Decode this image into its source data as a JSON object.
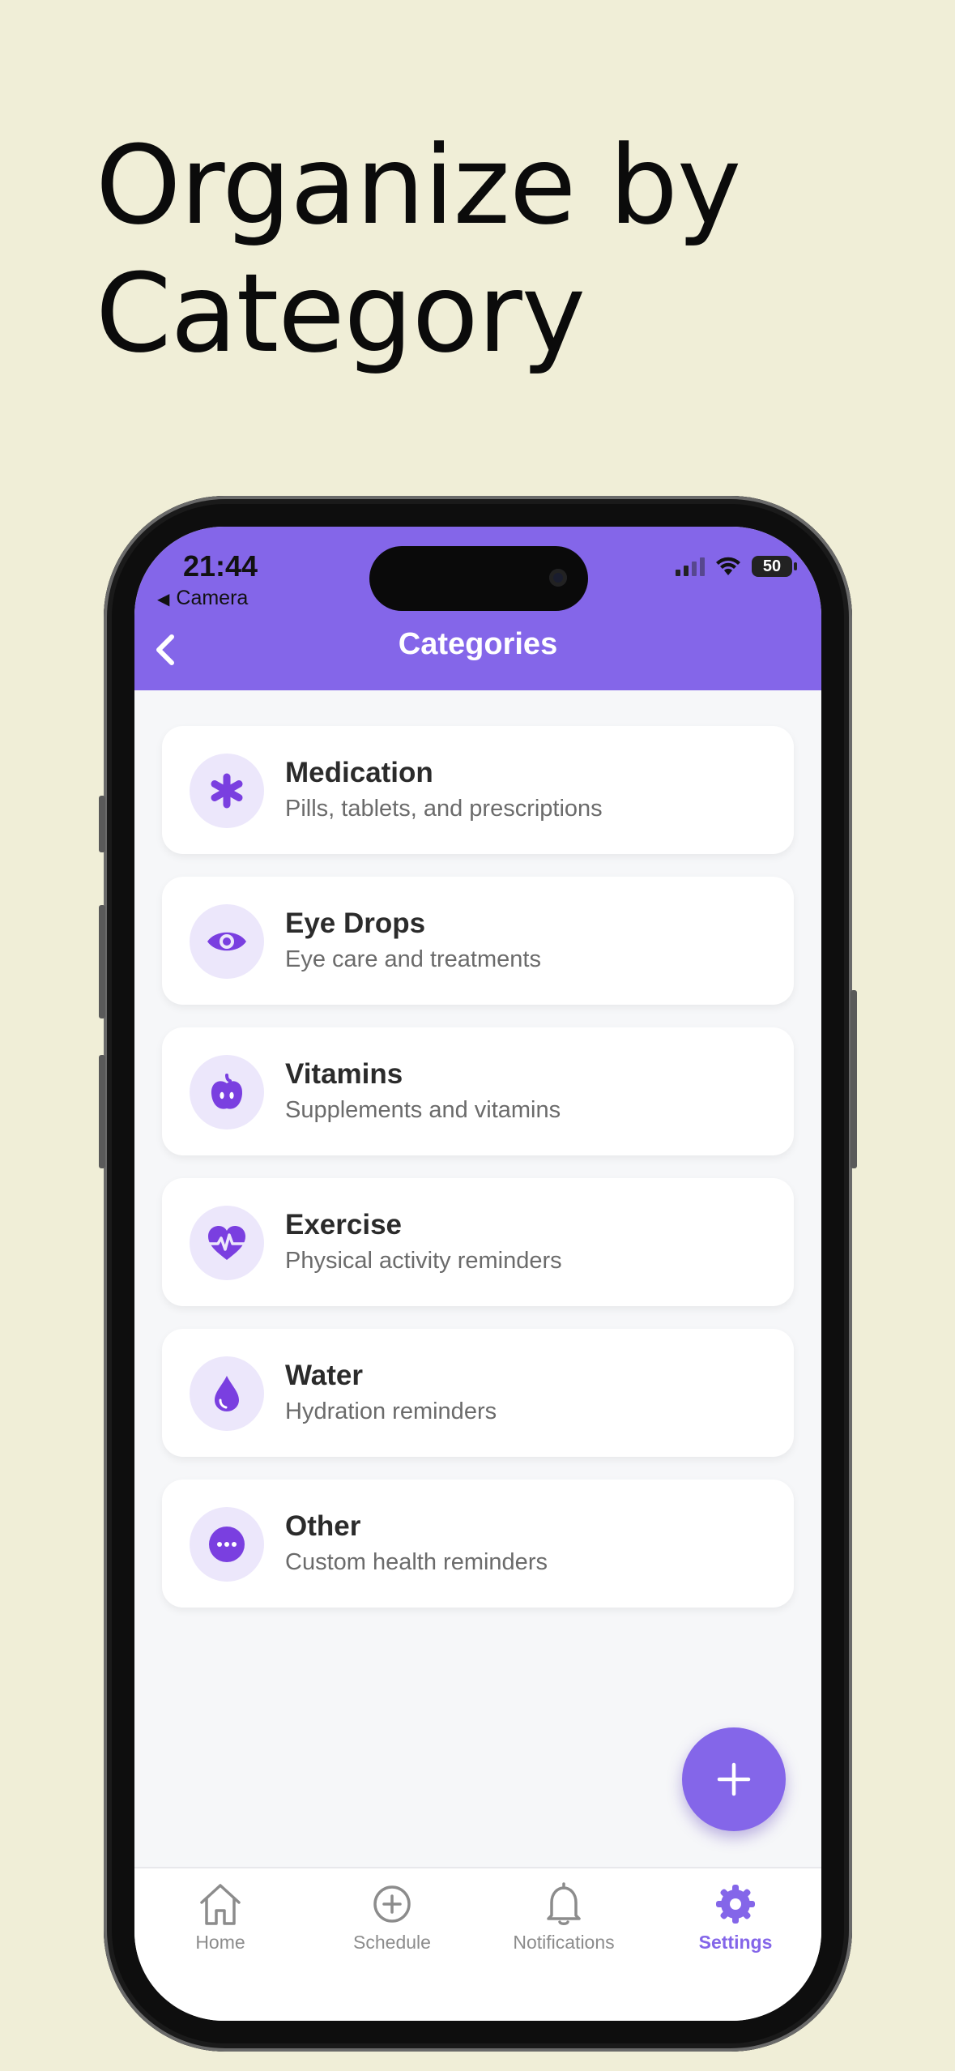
{
  "headline": {
    "line1": "Organize by",
    "line2": "Category"
  },
  "status_bar": {
    "time": "21:44",
    "back_app": "Camera",
    "battery": "50"
  },
  "nav": {
    "title": "Categories"
  },
  "categories": [
    {
      "title": "Medication",
      "subtitle": "Pills, tablets, and prescriptions",
      "icon": "asterisk-icon"
    },
    {
      "title": "Eye Drops",
      "subtitle": "Eye care and treatments",
      "icon": "eye-icon"
    },
    {
      "title": "Vitamins",
      "subtitle": "Supplements and vitamins",
      "icon": "apple-icon"
    },
    {
      "title": "Exercise",
      "subtitle": "Physical activity reminders",
      "icon": "heartbeat-icon"
    },
    {
      "title": "Water",
      "subtitle": "Hydration reminders",
      "icon": "water-drop-icon"
    },
    {
      "title": "Other",
      "subtitle": "Custom health reminders",
      "icon": "ellipsis-circle-icon"
    }
  ],
  "tabs": [
    {
      "label": "Home",
      "icon": "home-icon",
      "active": false
    },
    {
      "label": "Schedule",
      "icon": "plus-circle-icon",
      "active": false
    },
    {
      "label": "Notifications",
      "icon": "bell-icon",
      "active": false
    },
    {
      "label": "Settings",
      "icon": "gear-icon",
      "active": true
    }
  ],
  "colors": {
    "accent": "#8466e9",
    "page_background": "#f0eed7",
    "icon_background": "#ece7fb"
  }
}
